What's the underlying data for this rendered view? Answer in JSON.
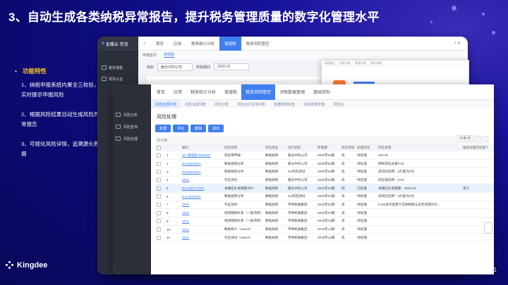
{
  "title": "3、自动生成各类纳税异常报告，提升税务管理质量的数字化管理水平",
  "features": {
    "heading": "功能特性",
    "items": [
      "1、纳税申报系统内置全三校验，实时提示申报风险",
      "2、根据风险结果自动生成风险异常报告",
      "3、可视化风险详情，追溯源头数据"
    ]
  },
  "brand": "Kingdee",
  "page_number": "1",
  "back_window": {
    "logo": "金蝶云·苍穹",
    "nav": [
      "首页",
      "应用",
      "税务统计分析",
      "增值税",
      "税务风险管控"
    ],
    "active_nav": "增值税",
    "side": [
      "税务报税",
      "发票认证"
    ],
    "tabs": [
      "申报首页",
      "增值税"
    ],
    "filter": {
      "org_label": "组织",
      "org_value": "鹿光中的公司",
      "period_label": "所属期间",
      "period_value": "2020-02"
    }
  },
  "front_window": {
    "nav": [
      "首页",
      "应用",
      "税务统计分析",
      "增值税",
      "税务风险管控",
      "涉税数据管理",
      "基础资料"
    ],
    "active_nav": "税务风险管控",
    "side": [
      "风险分析",
      "风险查询",
      "风险处理"
    ],
    "tabs": [
      "风险处理列表",
      "风险设置列表",
      "风险分配",
      "风险运行清单列表",
      "数据规则标签",
      "风险结果管理",
      "风险设"
    ],
    "active_tab": "风险处理列表",
    "page_title": "风险处理",
    "buttons": [
      "处理",
      "评论",
      "撤销",
      "退出"
    ],
    "bar_text": "共10条",
    "pager": "20条/页",
    "columns": [
      "",
      "编码",
      "风险名称",
      "风险类型",
      "运行组织",
      "所属期",
      "风险等级",
      "处理状态",
      "风险说明",
      "推送处理的处理人"
    ],
    "rows": [
      [
        "1",
        "SZ-增值税-0000087",
        "连续零申报",
        "数据规则",
        "鹿光中的公司",
        "2020年02期",
        "高",
        "待处理",
        "200.00",
        ""
      ],
      [
        "2",
        "Number0001",
        "数据规则分析",
        "数据规则",
        "鹿光中的公司",
        "2020年02期",
        "高",
        "待处理",
        "附税风险总量0.00",
        ""
      ],
      [
        "3",
        "Number0001",
        "数据规则分析",
        "数据规则",
        "SS风险测试",
        "2020年02期",
        "高",
        "待处理",
        "高风险说明：5元素为0为",
        ""
      ],
      [
        "4",
        "2001",
        "凭证测试",
        "数据规则",
        "鹿光中的公司",
        "2020年02期",
        "高",
        "待处理",
        "风险值说明：0.00",
        ""
      ],
      [
        "5",
        "BCHS01-TEST",
        "本期应补退税额为57",
        "数据规则",
        "鹿光中的公司",
        "2020年02期",
        "低",
        "已处理",
        "本期应补退税额：3402.00",
        "李三"
      ],
      [
        "6",
        "Number0001",
        "数据规则分析",
        "数据规则",
        "SS风险测试",
        "2020年01期",
        "高",
        "待处理",
        "高风险说明：5元素为0为",
        ""
      ],
      [
        "7",
        "2001",
        "凭证测试",
        "数据规则",
        "环球机械集团",
        "2020年01期",
        "高",
        "待处理",
        "0.00(本年度累计应纳税额与去年同期对比...",
        ""
      ],
      [
        "8",
        "1001",
        "增值税税负率（一般项目）",
        "数据规则",
        "环球机械集团",
        "2020年01期",
        "高",
        "待处理",
        "",
        ""
      ],
      [
        "9",
        "1001",
        "增值税税负率（一般项目）",
        "数据规则",
        "环球机械集团",
        "2019年12期",
        "高",
        "待处理",
        "",
        ""
      ],
      [
        "10",
        "2001",
        "数据统计（match）",
        "数据规则",
        "环球机械集团",
        "2019年12期",
        "高",
        "待处理",
        "",
        ""
      ],
      [
        "11",
        "2001",
        "凭证测试（match）",
        "数据规则",
        "环球机械集团",
        "2019年11期",
        "高",
        "待处理",
        "",
        ""
      ]
    ],
    "highlight_row": 4
  },
  "popup": {
    "tabs": [
      "风险报告",
      "风险分析",
      "处理记录",
      "风险说明"
    ],
    "shield": "!"
  }
}
